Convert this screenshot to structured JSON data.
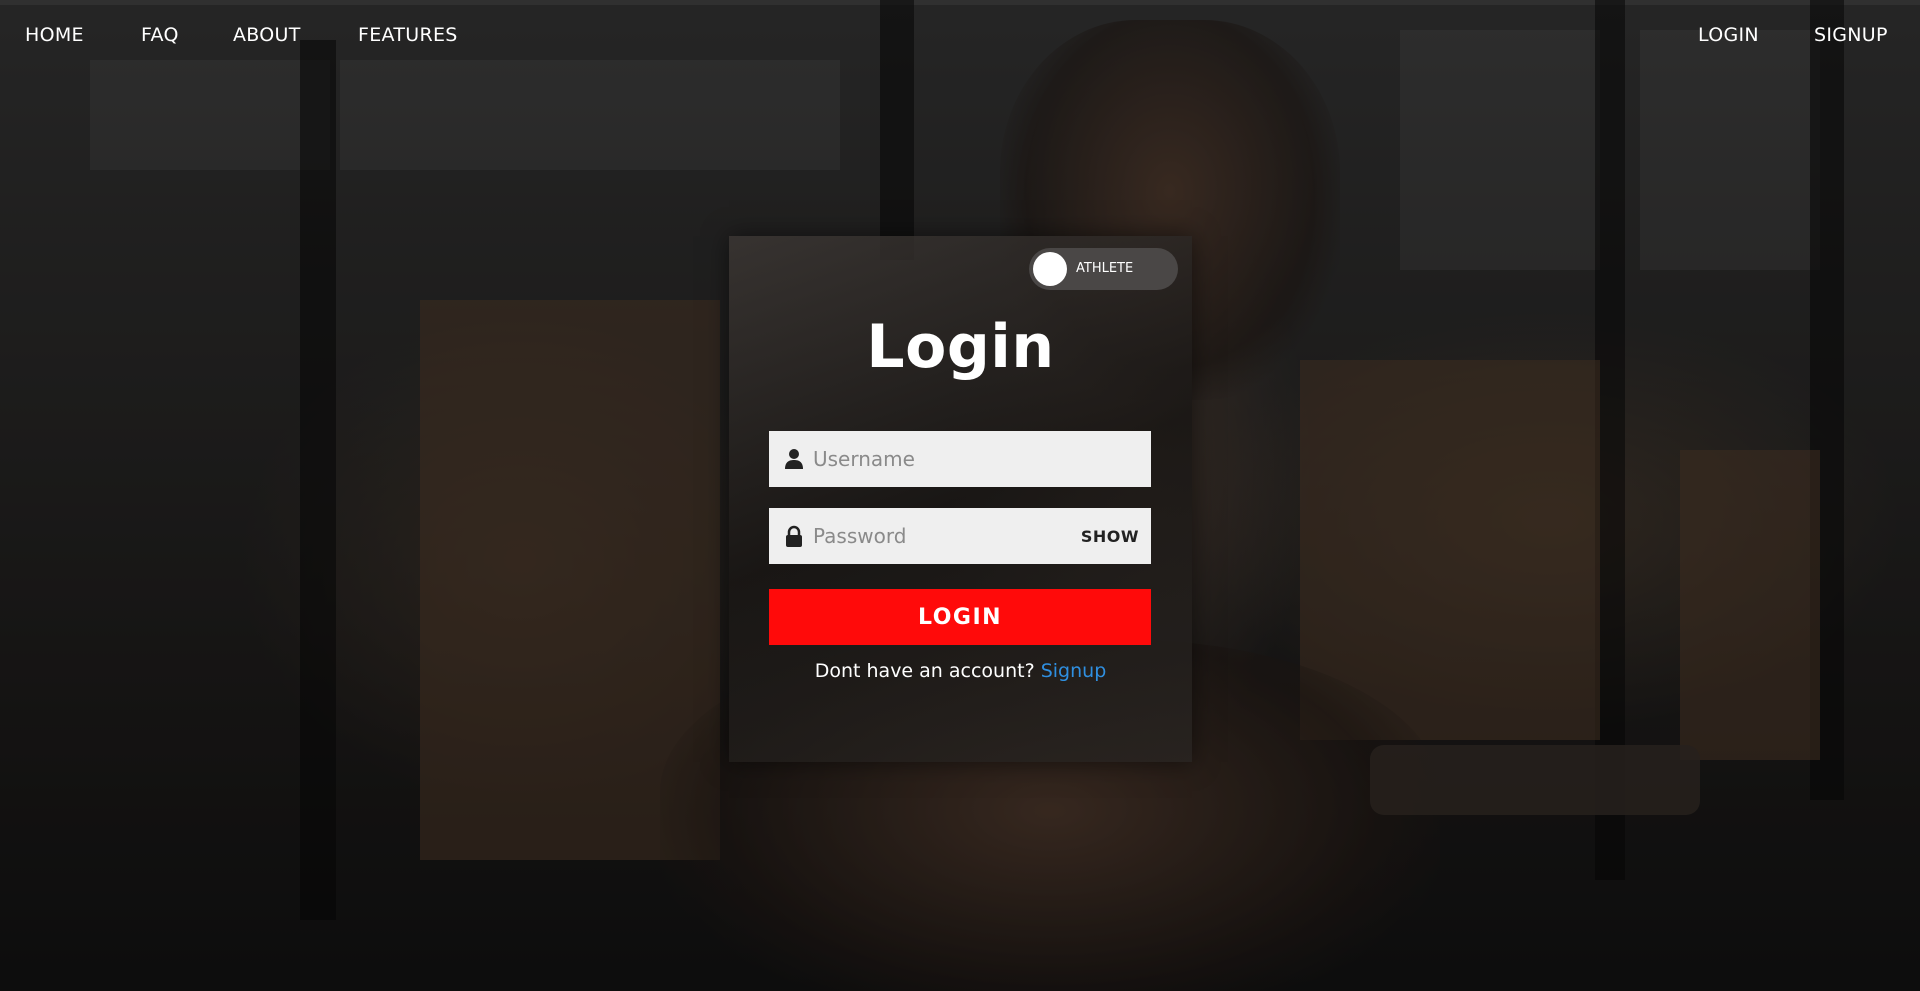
{
  "nav": {
    "left_links": [
      "HOME",
      "FAQ",
      "ABOUT",
      "FEATURES"
    ],
    "right_links": [
      "LOGIN",
      "SIGNUP"
    ]
  },
  "login_card": {
    "role_toggle": {
      "label": "ATHLETE",
      "state": "off"
    },
    "title": "Login",
    "username": {
      "placeholder": "Username",
      "value": "",
      "icon": "user-icon"
    },
    "password": {
      "placeholder": "Password",
      "value": "",
      "icon": "lock-icon",
      "toggle_label": "SHOW"
    },
    "submit_label": "LOGIN",
    "signup_prompt": "Dont have an account?",
    "signup_link": "Signup"
  },
  "colors": {
    "accent_red": "#ff0a0a",
    "link_blue": "#2f8fe0",
    "field_bg": "#efefef",
    "text_white": "#ffffff"
  }
}
